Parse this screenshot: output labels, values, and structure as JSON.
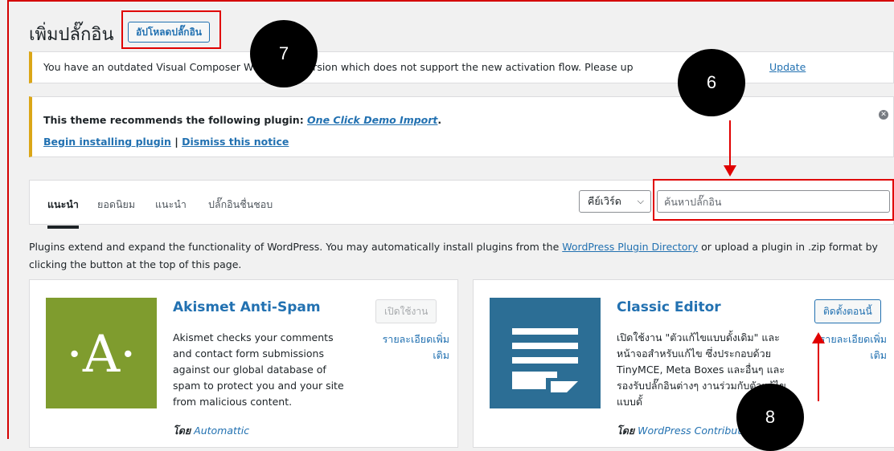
{
  "header": {
    "title": "เพิ่มปลั๊กอิน",
    "upload_label": "อัปโหลดปลั๊กอิน"
  },
  "notices": {
    "outdated": {
      "text_before": "You have an outdated Visual Composer We",
      "text_middle": "r plugin version which does not support the new activation flow. Please up",
      "update_link": "Update"
    },
    "theme": {
      "text": "This theme recommends the following plugin: ",
      "plugin_link": "One Click Demo Import",
      "period": ".",
      "begin_link": "Begin installing plugin",
      "separator": " | ",
      "dismiss_link": "Dismiss this notice"
    }
  },
  "filter": {
    "tabs": [
      "แนะนำ",
      "ยอดนิยม",
      "แนะนำ",
      "ปลั๊กอินชื่นชอบ"
    ],
    "select_value": "คีย์เวิร์ด",
    "search_placeholder": "ค้นหาปลั๊กอิน"
  },
  "intro": {
    "text_before": "Plugins extend and expand the functionality of WordPress. You may automatically install plugins from the ",
    "link": "WordPress Plugin Directory",
    "text_after": " or upload a plugin in .zip format by clicking the button at the top of this page."
  },
  "plugins": [
    {
      "name": "Akismet Anti-Spam",
      "description": "Akismet checks your comments and contact form submissions against our global database of spam to protect you and your site from malicious content.",
      "action": "เปิดใช้งาน",
      "more": "รายละเอียดเพิ่มเติม",
      "by": "โดย",
      "author": "Automattic",
      "logo_text": "·A·"
    },
    {
      "name": "Classic Editor",
      "description": "เปิดใช้งาน \"ตัวแก้ไขแบบดั้งเดิม\" และหน้าจอสำหรับแก้ไข ซึ่งประกอบด้วย TinyMCE, Meta Boxes และอื่นๆ และรองรับปลั๊กอินต่างๆ งานร่วมกับตัวแก้ไขแบบดั้",
      "action": "ติดตั้งตอนนี้",
      "more": "รายละเอียดเพิ่มเติม",
      "by": "โดย",
      "author": "WordPress Contribut"
    }
  ],
  "markers": [
    "7",
    "6",
    "8"
  ],
  "colors": {
    "accent": "#2271b1",
    "warning": "#dba617",
    "annotation": "#e00000",
    "akismet_green": "#7f9c2e",
    "classic_blue": "#2c6e95"
  }
}
